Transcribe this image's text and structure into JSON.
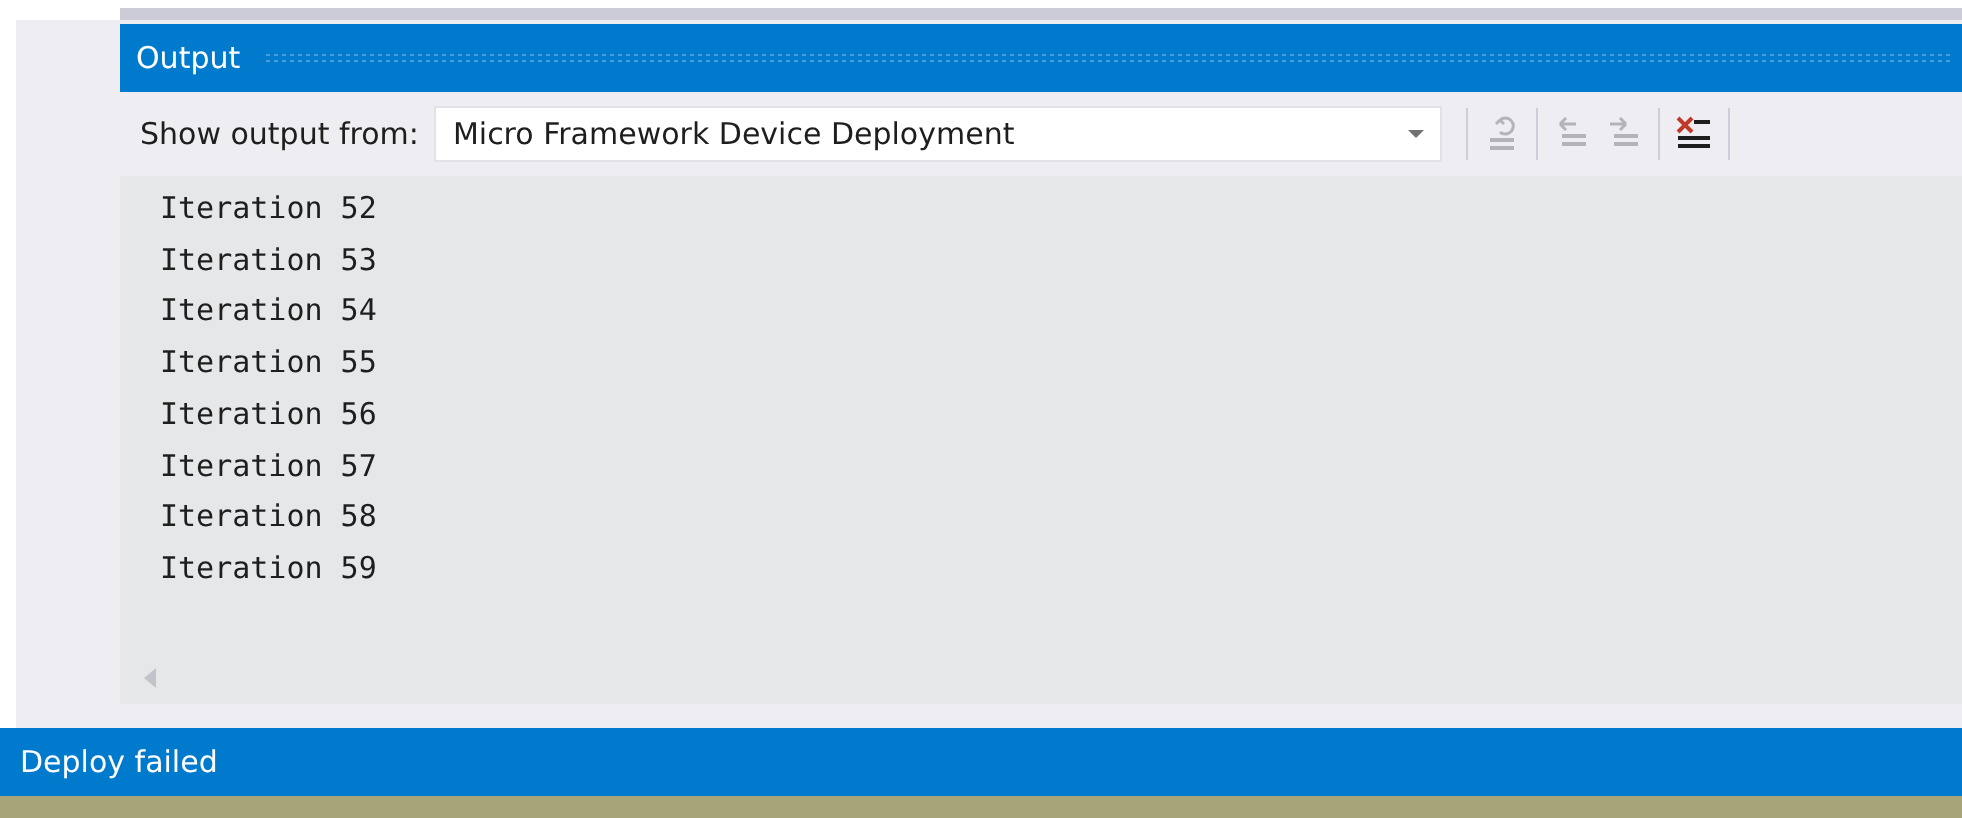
{
  "panel": {
    "title": "Output"
  },
  "toolbar": {
    "label": "Show output from:",
    "source": {
      "value": "Micro Framework Device Deployment"
    },
    "buttons": [
      {
        "kind": "find-source",
        "disabled": true
      },
      {
        "kind": "previous",
        "disabled": true
      },
      {
        "kind": "next",
        "disabled": true
      },
      {
        "kind": "clear-all",
        "disabled": false
      }
    ]
  },
  "output_lines": [
    "Iteration 52",
    "Iteration 53",
    "Iteration 54",
    "Iteration 55",
    "Iteration 56",
    "Iteration 57",
    "Iteration 58",
    "Iteration 59"
  ],
  "status_bar": {
    "text": "Deploy failed"
  }
}
